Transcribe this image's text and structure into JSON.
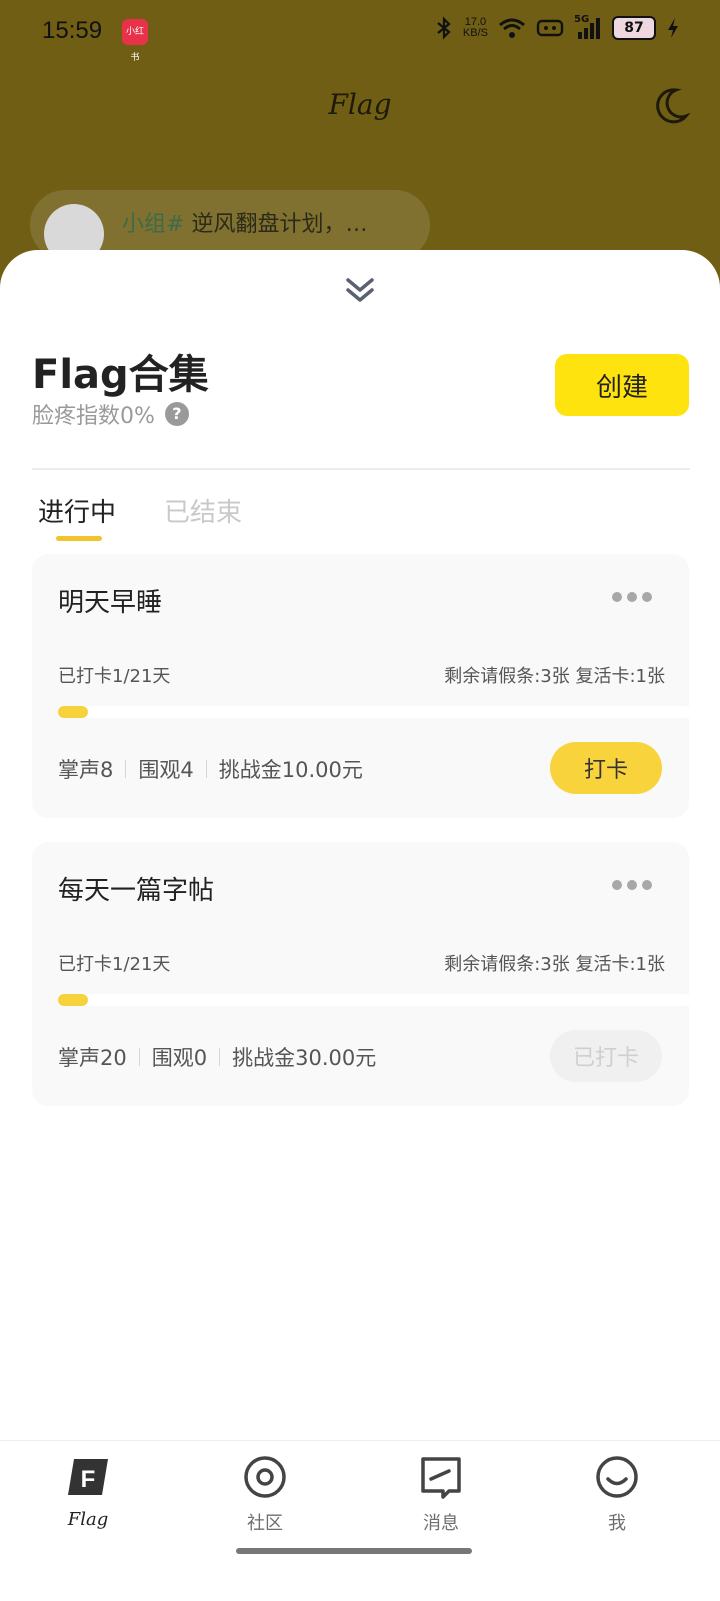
{
  "status_bar": {
    "time": "15:59",
    "app_badge": "小红书",
    "net_speed_value": "17.0",
    "net_speed_unit": "KB/S",
    "signal_label": "5G",
    "battery": "87"
  },
  "header": {
    "title": "Flag",
    "theme_icon": "moon-icon"
  },
  "background_post": {
    "tag": "小组#",
    "text": "逆风翻盘计划，…"
  },
  "sheet": {
    "title": "Flag合集",
    "subtitle": "脸疼指数0%",
    "help_icon": "?",
    "create_label": "创建",
    "tabs": [
      {
        "label": "进行中",
        "active": true
      },
      {
        "label": "已结束",
        "active": false
      }
    ]
  },
  "flags": [
    {
      "name": "明天早睡",
      "checked_days": "已打卡1/21天",
      "remaining": "剩余请假条:3张  复活卡:1张",
      "progress": 0.0476,
      "claps": "掌声8",
      "watchers": "围观4",
      "stake": "挑战金10.00元",
      "action_label": "打卡",
      "action_enabled": true
    },
    {
      "name": "每天一篇字帖",
      "checked_days": "已打卡1/21天",
      "remaining": "剩余请假条:3张  复活卡:1张",
      "progress": 0.0476,
      "claps": "掌声20",
      "watchers": "围观0",
      "stake": "挑战金30.00元",
      "action_label": "已打卡",
      "action_enabled": false
    }
  ],
  "bottom_nav": [
    {
      "label": "Flag",
      "icon": "flag-icon",
      "active": true
    },
    {
      "label": "社区",
      "icon": "community-icon",
      "active": false
    },
    {
      "label": "消息",
      "icon": "message-icon",
      "active": false
    },
    {
      "label": "我",
      "icon": "profile-icon",
      "active": false
    }
  ],
  "colors": {
    "accent": "#ffe30e",
    "progress": "#f6d33c",
    "overlay": "#6f5e14"
  }
}
